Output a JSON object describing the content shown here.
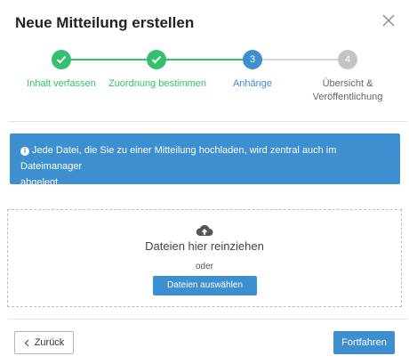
{
  "dialog": {
    "title": "Neue Mitteilung erstellen"
  },
  "steps": [
    {
      "number": "1",
      "label": "Inhalt verfassen",
      "state": "done"
    },
    {
      "number": "2",
      "label": "Zuordnung bestimmen",
      "state": "done"
    },
    {
      "number": "3",
      "label": "Anhänge",
      "state": "active"
    },
    {
      "number": "4",
      "label_line1": "Übersicht &",
      "label_line2": "Veröffentlichung",
      "state": "pending"
    }
  ],
  "info": {
    "line1": "Jede Datei, die Sie zu einer Mitteilung hochladen, wird zentral auch im Dateimanager",
    "line2": "abgelegt."
  },
  "dropzone": {
    "text": "Dateien hier reinziehen",
    "or": "oder",
    "button": "Dateien auswählen"
  },
  "footer": {
    "back": "Zurück",
    "next": "Fortfahren"
  },
  "colors": {
    "success": "#35c06e",
    "primary": "#3d8fcf",
    "pending": "#c4c4c4"
  }
}
